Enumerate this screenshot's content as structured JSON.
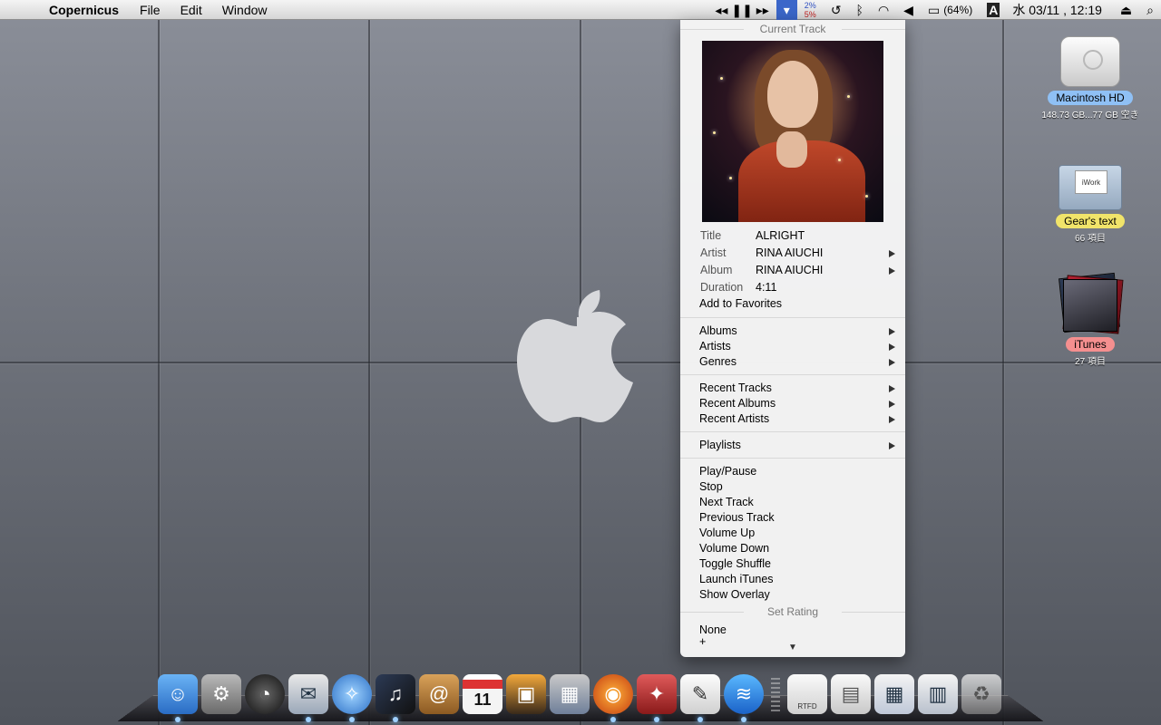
{
  "menubar": {
    "app_name": "Copernicus",
    "menus": [
      "File",
      "Edit",
      "Window"
    ],
    "cpu_top": "2%",
    "cpu_bottom": "5%",
    "battery": "(64%)",
    "input_method": "A",
    "clock": "水 03/11 , 12:19"
  },
  "desktop": {
    "items": [
      {
        "label": "Macintosh HD",
        "sub": "148.73 GB...77 GB 空き",
        "label_color": "#8fc0f5"
      },
      {
        "label": "Gear's text",
        "sub": "66 項目",
        "label_color": "#f1e46a",
        "folder_text": "iWork"
      },
      {
        "label": "iTunes",
        "sub": "27 項目",
        "label_color": "#f58f8f"
      }
    ]
  },
  "dropdown": {
    "current_track_title": "Current Track",
    "track": {
      "title_key": "Title",
      "title": "ALRIGHT",
      "artist_key": "Artist",
      "artist": "RINA AIUCHI",
      "album_key": "Album",
      "album": "RINA AIUCHI",
      "duration_key": "Duration",
      "duration": "4:11"
    },
    "add_to_favorites": "Add to Favorites",
    "browse": [
      "Albums",
      "Artists",
      "Genres"
    ],
    "recent": [
      "Recent Tracks",
      "Recent Albums",
      "Recent Artists"
    ],
    "playlists": "Playlists",
    "controls": [
      "Play/Pause",
      "Stop",
      "Next Track",
      "Previous Track",
      "Volume Up",
      "Volume Down",
      "Toggle Shuffle",
      "Launch iTunes",
      "Show Overlay"
    ],
    "set_rating_title": "Set Rating",
    "rating_none": "None",
    "rating_partial": "+"
  },
  "dock": {
    "apps": [
      "Finder",
      "System Preferences",
      "Dashboard",
      "Mail",
      "Safari",
      "iTunes",
      "Address Book",
      "iCal",
      "iPhoto",
      "Spaces",
      "Firefox",
      "TextMate",
      "TextEdit",
      "Copernicus"
    ],
    "calendar_day": "11",
    "docs": [
      "RTFD",
      "Document",
      "Screenshot",
      "Screenshot 2",
      "Trash"
    ],
    "rtfd_label": "RTFD"
  }
}
